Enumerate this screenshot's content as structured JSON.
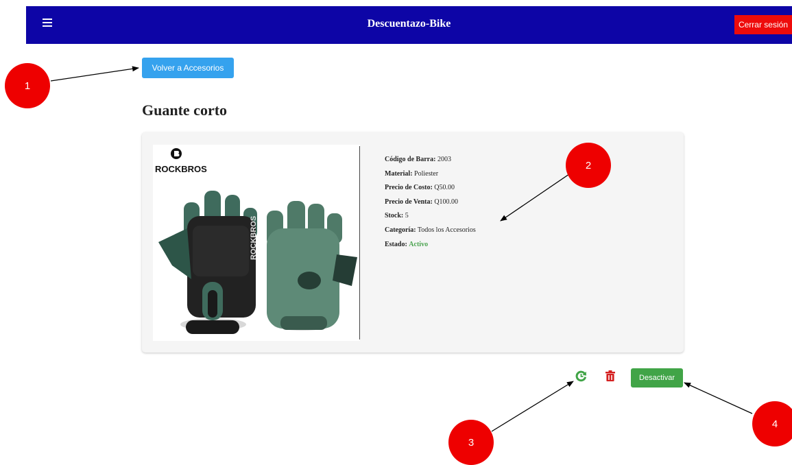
{
  "header": {
    "menu_icon": "hamburger-menu-icon",
    "title": "Descuentazo-Bike",
    "logout_label": "Cerrar sesión"
  },
  "back_button": {
    "label": "Volver a Accesorios"
  },
  "product": {
    "name": "Guante corto",
    "image": {
      "brand_text": "ROCKBROS",
      "glove_print": "ROCKBROS"
    },
    "fields": [
      {
        "label": "Código de Barra:",
        "value": "2003"
      },
      {
        "label": "Material:",
        "value": "Poliester"
      },
      {
        "label": "Precio de Costo:",
        "value": "Q50.00"
      },
      {
        "label": "Precio de Venta:",
        "value": "Q100.00"
      },
      {
        "label": "Stock:",
        "value": "5"
      },
      {
        "label": "Categoría:",
        "value": "Todos los Accesorios"
      },
      {
        "label": "Estado:",
        "value": "Activo"
      }
    ]
  },
  "actions": {
    "history_icon": "history-icon",
    "delete_icon": "trash-icon",
    "deactivate_label": "Desactivar"
  },
  "annotations": [
    "1",
    "2",
    "3",
    "4"
  ],
  "colors": {
    "header_bg": "#0d05a6",
    "logout_bg": "#ee0b0b",
    "back_button_bg": "#35a2ee",
    "active_status": "#4aa34f",
    "deactivate_bg": "#41a447",
    "delete_icon": "#d42020",
    "marker": "#ee0000"
  }
}
